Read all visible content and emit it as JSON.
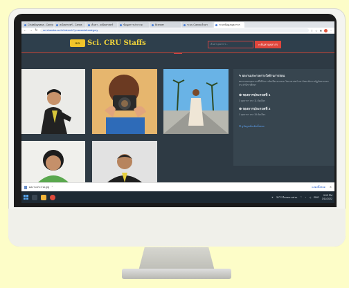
{
  "browser": {
    "tabs": [
      {
        "label": "ChulaBoysana - Canva",
        "active": false
      },
      {
        "label": "คณิตศาสตร์ - Canva",
        "active": false
      },
      {
        "label": "ค้นหา - คณิตศาสตร์",
        "active": false
      },
      {
        "label": "ข้อมูลการประกวด",
        "active": false
      },
      {
        "label": "Branner",
        "active": false
      },
      {
        "label": "ระบบ Canva ค้นหา",
        "active": false
      },
      {
        "label": "ระบบข้อมูลบุคลากร",
        "active": true
      }
    ],
    "url": "sci.chandra.ac.th/internet/?p=awards&category"
  },
  "site": {
    "logo_badge": "SCI",
    "logo_text": "Sci. CRU Staffs",
    "search_placeholder": "ค้นหาบุคลากร...",
    "search_button": "ค้นหาบุคลากร"
  },
  "panel": {
    "title": "ผลงานประกวดรางวัลด้านการสอน",
    "description": "ผลงานของบุคลากรที่ได้รับการคัดเลือกจากคณะวิทยาศาสตร์ มหาวิทยาลัยราชภัฏจันทรเกษม ประจำปีการศึกษา",
    "award1_title": "รองการประกวดที่ 1",
    "award1_sub": "1 บุคลากร จาก 11 คัดเลือก",
    "award2_title": "รองการประกวดที่ 2",
    "award2_sub": "1 บุคลากร จาก 15 คัดเลือก",
    "link": "ดูข้อมูลเพิ่มเติมทั้งหมด"
  },
  "download": {
    "file": "ผลงานประกวด.jpg",
    "show_all": "แสดงทั้งหมด"
  },
  "taskbar": {
    "weather": "31°C มีแดดบางส่วน",
    "time": "9:03 PM",
    "date": "3/11/2022",
    "lang": "ENG"
  },
  "colors": {
    "accent": "#e0463c",
    "logo": "#f2d43a",
    "page_bg": "#2e3a44",
    "frame": "#fdfdc8"
  }
}
